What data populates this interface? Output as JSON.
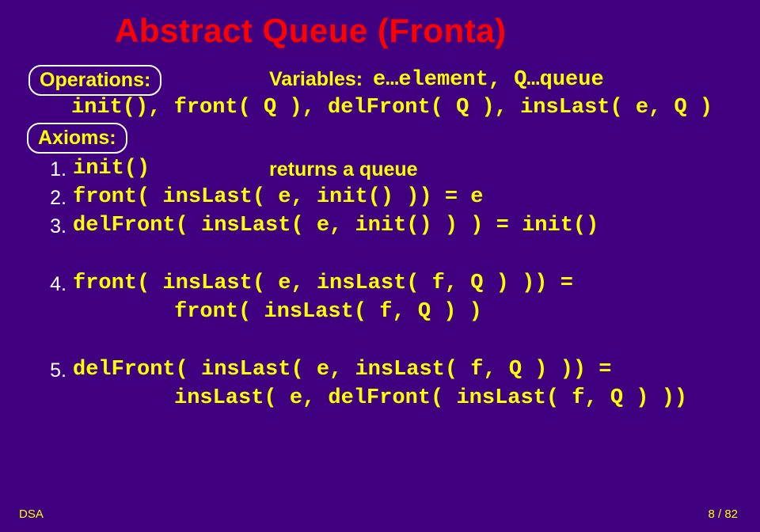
{
  "title": "Abstract Queue (Fronta)",
  "labels": {
    "operations": "Operations:",
    "axioms": "Axioms:",
    "variables": "Variables: ",
    "returns_a_queue": "returns a queue"
  },
  "variables_code": "e…element, Q…queue",
  "ops_code": "init(), front( Q ), delFront( Q ), insLast( e, Q )",
  "axioms": {
    "n1": "1.",
    "n2": "2.",
    "n3": "3.",
    "n4": "4.",
    "n5": "5.",
    "a1_code": "init()",
    "a2": "front( insLast( e, init() )) = e",
    "a3": "delFront( insLast( e, init() ) ) = init()",
    "a4a": "front( insLast( e, insLast( f, Q ) )) =",
    "a4b": "front( insLast( f, Q ) )",
    "a5a": "delFront( insLast( e, insLast( f, Q ) )) =",
    "a5b": "insLast( e, delFront( insLast( f, Q ) ))"
  },
  "footer": {
    "left": "DSA",
    "right": "8 / 82"
  }
}
